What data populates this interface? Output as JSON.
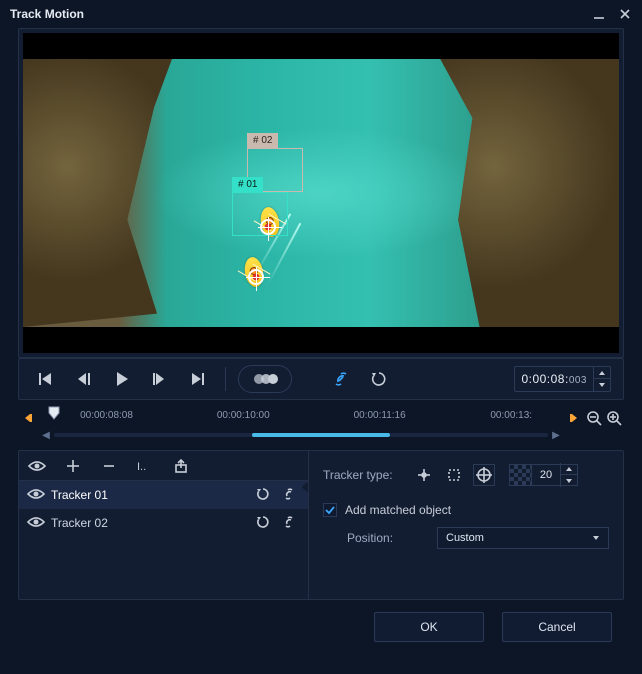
{
  "window": {
    "title": "Track Motion"
  },
  "preview": {
    "box1_label": "# 01",
    "box2_label": "# 02"
  },
  "transport": {
    "timecode": "0:00:08:",
    "timecode_ms": "003"
  },
  "timeline": {
    "labels": [
      "00:00:08:08",
      "00:00:10:00",
      "00:00:11:16",
      "00:00:13:"
    ],
    "label_positions_pct": [
      8,
      34,
      60,
      86
    ],
    "playhead_pct": 3,
    "scroll_left_pct": 40,
    "scroll_width_pct": 28
  },
  "trackers": {
    "items": [
      {
        "name": "Tracker 01",
        "selected": true
      },
      {
        "name": "Tracker 02",
        "selected": false
      }
    ]
  },
  "props": {
    "type_label": "Tracker type:",
    "size_value": "20",
    "add_matched_label": "Add matched object",
    "add_matched_checked": true,
    "position_label": "Position:",
    "position_value": "Custom"
  },
  "footer": {
    "ok": "OK",
    "cancel": "Cancel"
  }
}
